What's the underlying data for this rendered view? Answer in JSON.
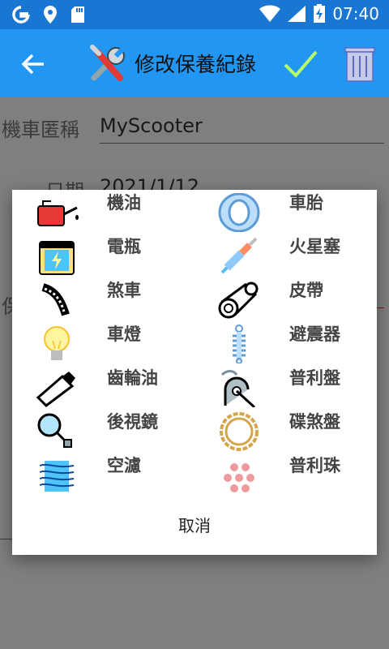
{
  "status_bar": {
    "icons": [
      "google-g-icon",
      "location-pin-icon",
      "sd-card-icon",
      "wifi-icon",
      "signal-icon",
      "battery-charging-icon"
    ],
    "time": "07:40"
  },
  "app_bar": {
    "title": "修改保養紀錄",
    "back_icon": "arrow-back-icon",
    "title_icon": "tools-icon",
    "save_icon": "check-icon",
    "delete_icon": "trash-icon"
  },
  "form": {
    "vehicle_label": "機車匿稱",
    "vehicle_value": "MyScooter",
    "date_label": "日期",
    "date_value": "2021/1/12",
    "third_label": "保"
  },
  "dialog": {
    "items": [
      {
        "label": "機油",
        "icon": "oil-can-icon"
      },
      {
        "label": "車胎",
        "icon": "tire-icon"
      },
      {
        "label": "電瓶",
        "icon": "battery-icon"
      },
      {
        "label": "火星塞",
        "icon": "spark-plug-icon"
      },
      {
        "label": "煞車",
        "icon": "brake-pad-icon"
      },
      {
        "label": "皮帶",
        "icon": "drive-belt-icon"
      },
      {
        "label": "車燈",
        "icon": "light-bulb-icon"
      },
      {
        "label": "避震器",
        "icon": "shock-absorber-icon"
      },
      {
        "label": "齒輪油",
        "icon": "gear-oil-tube-icon"
      },
      {
        "label": "普利盤",
        "icon": "pulley-icon"
      },
      {
        "label": "後視鏡",
        "icon": "mirror-icon"
      },
      {
        "label": "碟煞盤",
        "icon": "brake-disc-icon"
      },
      {
        "label": "空濾",
        "icon": "air-filter-icon"
      },
      {
        "label": "普利珠",
        "icon": "roller-weights-icon"
      }
    ],
    "cancel_label": "取消"
  },
  "colors": {
    "status_bar": "#1976d2",
    "app_bar": "#2196f3",
    "scrim": "rgba(0,0,0,0.5)",
    "dialog_bg": "#ffffff",
    "check": "#b6ff6a"
  }
}
